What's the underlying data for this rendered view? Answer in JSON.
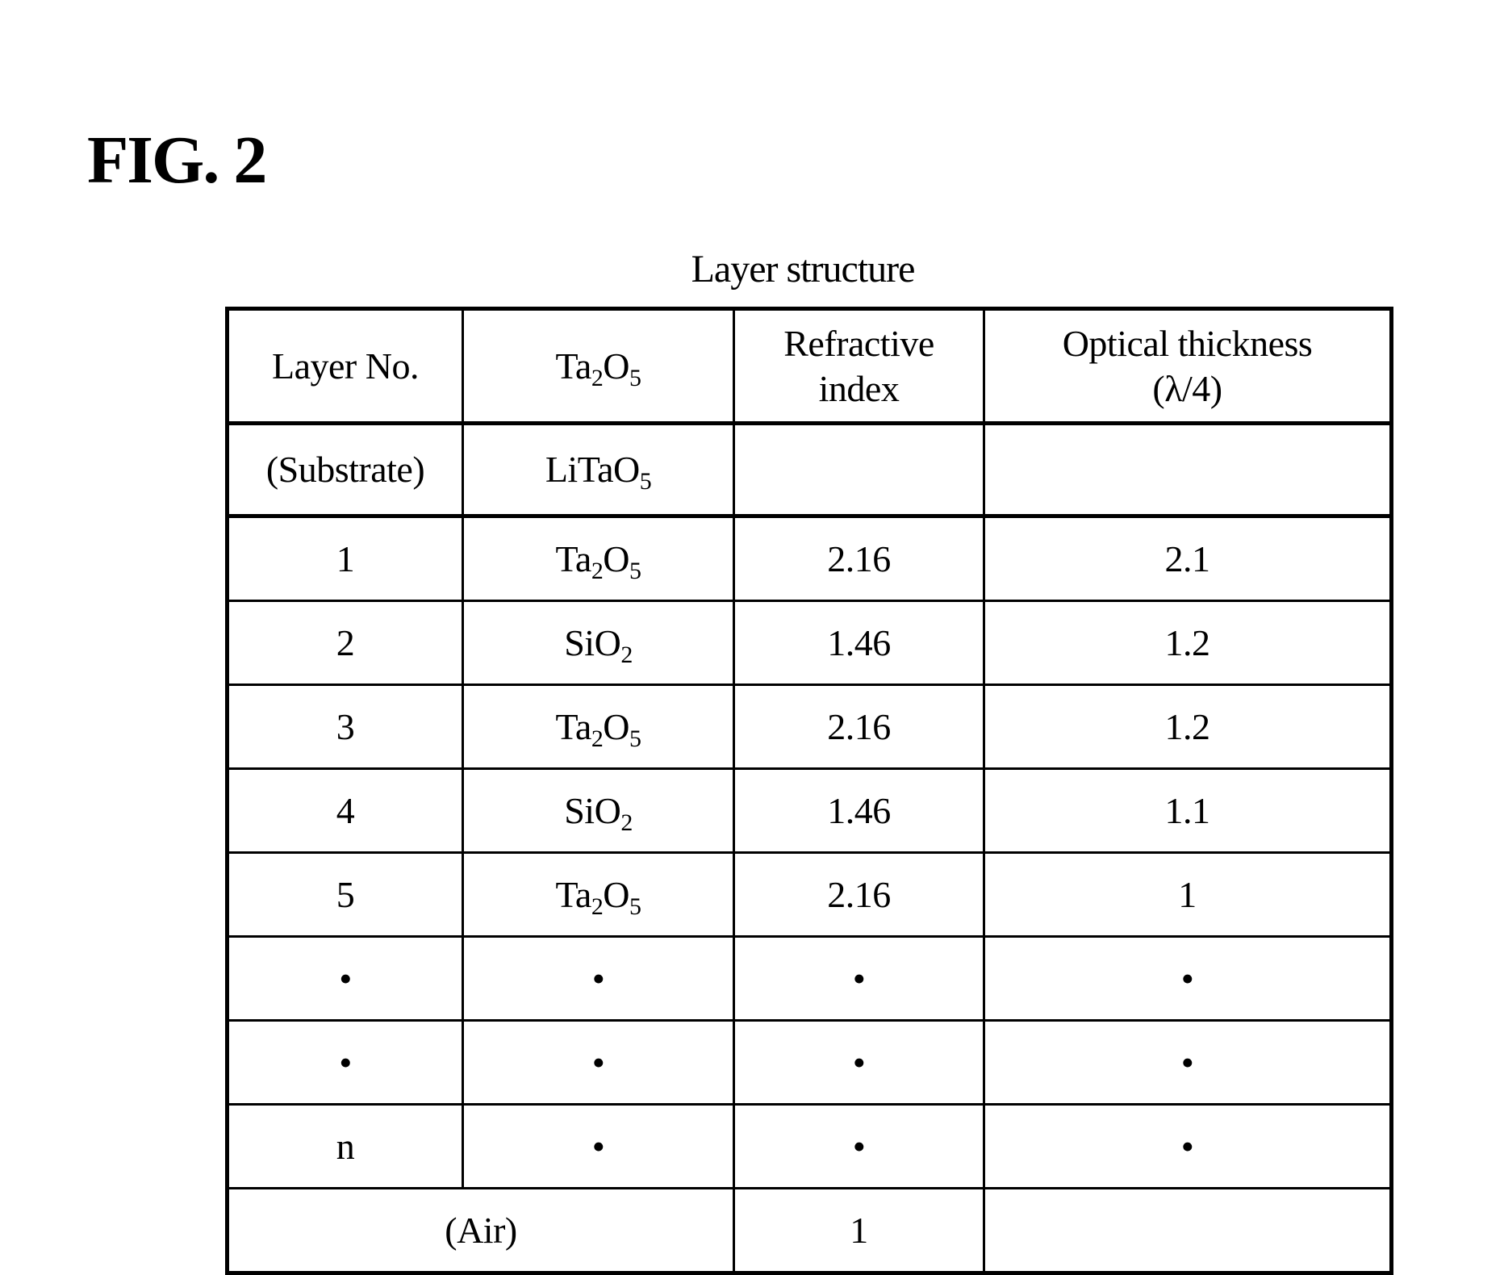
{
  "figure": {
    "label": "FIG. 2"
  },
  "table": {
    "title": "Layer structure",
    "headers": {
      "layer_no": "Layer No.",
      "material": {
        "base": "Ta",
        "sub1": "2",
        "mid": "O",
        "sub2": "5"
      },
      "refractive_index": [
        "Refractive",
        "index"
      ],
      "optical_thickness": [
        "Optical thickness",
        "(λ/4)"
      ]
    },
    "substrate_row": {
      "layer": "(Substrate)",
      "material": {
        "base": "LiTaO",
        "sub": "5"
      },
      "refractive_index": "",
      "optical_thickness": ""
    },
    "rows": [
      {
        "layer": "1",
        "material": {
          "base": "Ta",
          "sub1": "2",
          "mid": "O",
          "sub2": "5"
        },
        "refractive_index": "2.16",
        "optical_thickness": "2.1"
      },
      {
        "layer": "2",
        "material": {
          "base": "SiO",
          "sub1": "2",
          "mid": "",
          "sub2": ""
        },
        "refractive_index": "1.46",
        "optical_thickness": "1.2"
      },
      {
        "layer": "3",
        "material": {
          "base": "Ta",
          "sub1": "2",
          "mid": "O",
          "sub2": "5"
        },
        "refractive_index": "2.16",
        "optical_thickness": "1.2"
      },
      {
        "layer": "4",
        "material": {
          "base": "SiO",
          "sub1": "2",
          "mid": "",
          "sub2": ""
        },
        "refractive_index": "1.46",
        "optical_thickness": "1.1"
      },
      {
        "layer": "5",
        "material": {
          "base": "Ta",
          "sub1": "2",
          "mid": "O",
          "sub2": "5"
        },
        "refractive_index": "2.16",
        "optical_thickness": "1"
      }
    ],
    "ellipsis_rows": [
      {
        "layer": "•",
        "material": "•",
        "refractive_index": "•",
        "optical_thickness": "•"
      },
      {
        "layer": "•",
        "material": "•",
        "refractive_index": "•",
        "optical_thickness": "•"
      },
      {
        "layer": "n",
        "material": "•",
        "refractive_index": "•",
        "optical_thickness": "•"
      }
    ],
    "air_row": {
      "label": "(Air)",
      "refractive_index": "1",
      "optical_thickness": ""
    }
  }
}
